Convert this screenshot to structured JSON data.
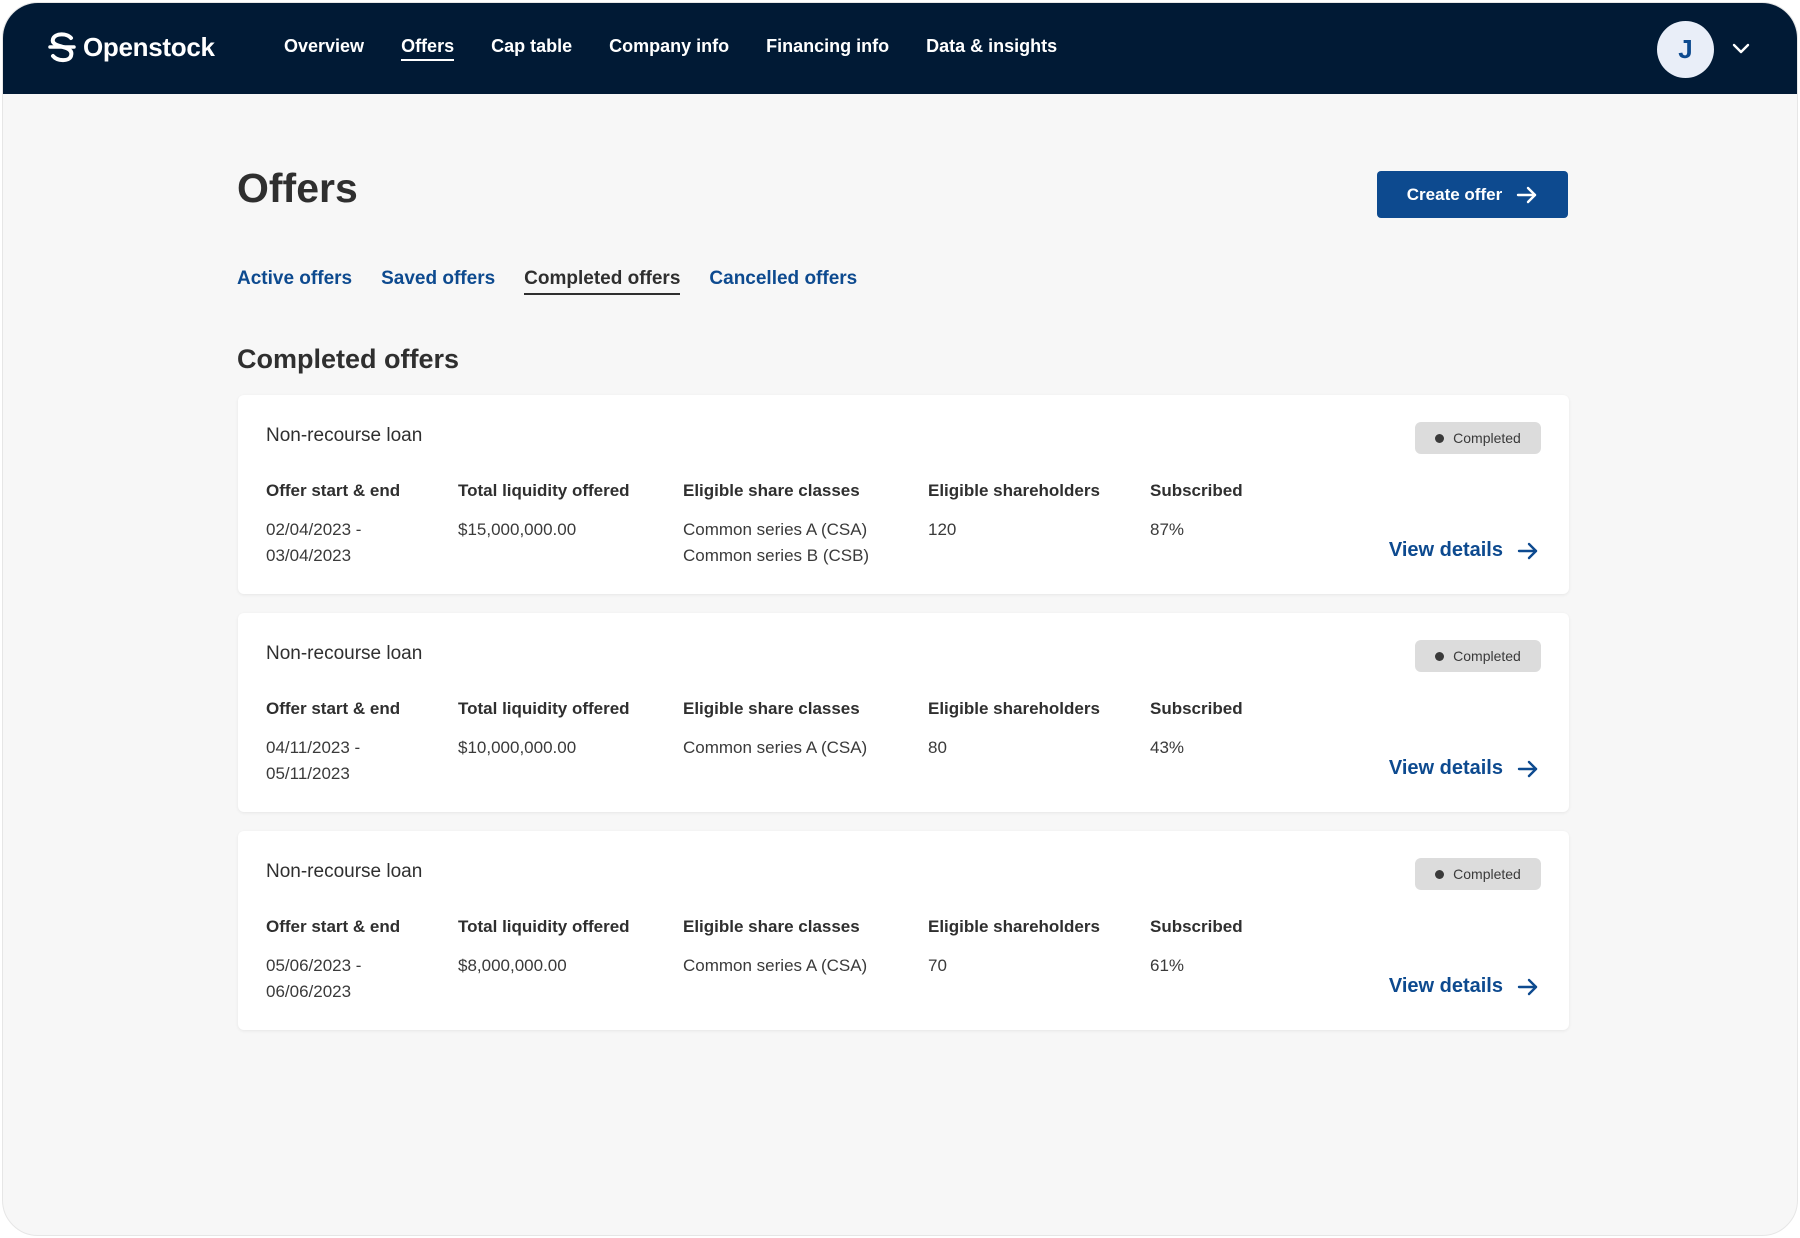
{
  "app": {
    "name": "Openstock"
  },
  "nav": {
    "items": [
      {
        "label": "Overview"
      },
      {
        "label": "Offers"
      },
      {
        "label": "Cap table"
      },
      {
        "label": "Company info"
      },
      {
        "label": "Financing info"
      },
      {
        "label": "Data & insights"
      }
    ],
    "active": "Offers",
    "avatar_initial": "J"
  },
  "header": {
    "title": "Offers",
    "create_label": "Create offer"
  },
  "tabs": [
    {
      "label": "Active offers"
    },
    {
      "label": "Saved offers"
    },
    {
      "label": "Completed offers"
    },
    {
      "label": "Cancelled offers"
    }
  ],
  "active_tab": "Completed offers",
  "section": {
    "title": "Completed offers"
  },
  "columns": {
    "dates": "Offer start & end",
    "liquidity": "Total liquidity offered",
    "classes": "Eligible share classes",
    "shareholders": "Eligible shareholders",
    "subscribed": "Subscribed"
  },
  "offers": [
    {
      "title": "Non-recourse loan",
      "status": "Completed",
      "start": "02/04/2023 -",
      "end": "03/04/2023",
      "liquidity": "$15,000,000.00",
      "class1": "Common series A (CSA)",
      "class2": "Common series B (CSB)",
      "shareholders": "120",
      "subscribed": "87%",
      "link": "View details"
    },
    {
      "title": "Non-recourse loan",
      "status": "Completed",
      "start": "04/11/2023 -",
      "end": "05/11/2023",
      "liquidity": "$10,000,000.00",
      "class1": "Common series A (CSA)",
      "class2": "",
      "shareholders": "80",
      "subscribed": "43%",
      "link": "View details"
    },
    {
      "title": "Non-recourse loan",
      "status": "Completed",
      "start": "05/06/2023 -",
      "end": "06/06/2023",
      "liquidity": "$8,000,000.00",
      "class1": "Common series A (CSA)",
      "class2": "",
      "shareholders": "70",
      "subscribed": "61%",
      "link": "View details"
    }
  ],
  "colors": {
    "nav_bg": "#011a35",
    "accent": "#0d4a8f",
    "badge_bg": "#dcdcdc",
    "page_bg": "#f7f7f7"
  },
  "icons": {
    "logo": "openstock-logo-icon",
    "arrow": "arrow-right-icon",
    "chevron": "chevron-down-icon",
    "dot": "status-dot-icon"
  }
}
